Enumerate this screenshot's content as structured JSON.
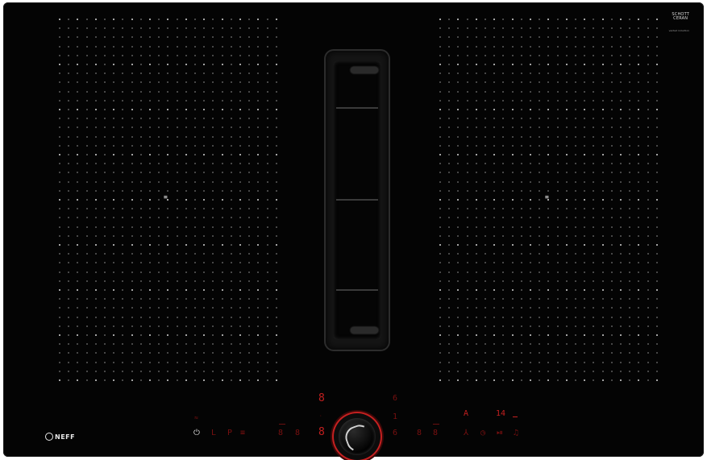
{
  "brand": {
    "neff": "NEFF",
    "schott_top": "SCHOTT",
    "schott_bottom": "CERAN",
    "schott_small": "vented induction"
  },
  "left_zone": {
    "icon": "flex-zone-icon",
    "label": "≡"
  },
  "right_zone": {
    "icon": "flex-zone-icon",
    "label": "≡"
  },
  "controls": {
    "left": {
      "wifi": "wifi-icon",
      "power": "power-icon",
      "lock": "L",
      "p": "P",
      "flex": "≡",
      "d1": "8",
      "d2": "8"
    },
    "center": {
      "top_digit": "8",
      "bottom_digit": "8",
      "right_top": "6",
      "right_mid": "1",
      "right_bottom": "6"
    },
    "right": {
      "a": "A",
      "timer": "14",
      "d1": "8",
      "d2": "8",
      "fan": "fan-icon",
      "clock": "clock-icon",
      "pause": "pause-icon",
      "bell": "bell-icon"
    }
  },
  "colors": {
    "surface": "#040404",
    "accent": "#c42020",
    "dot": "#5e5e5e"
  }
}
